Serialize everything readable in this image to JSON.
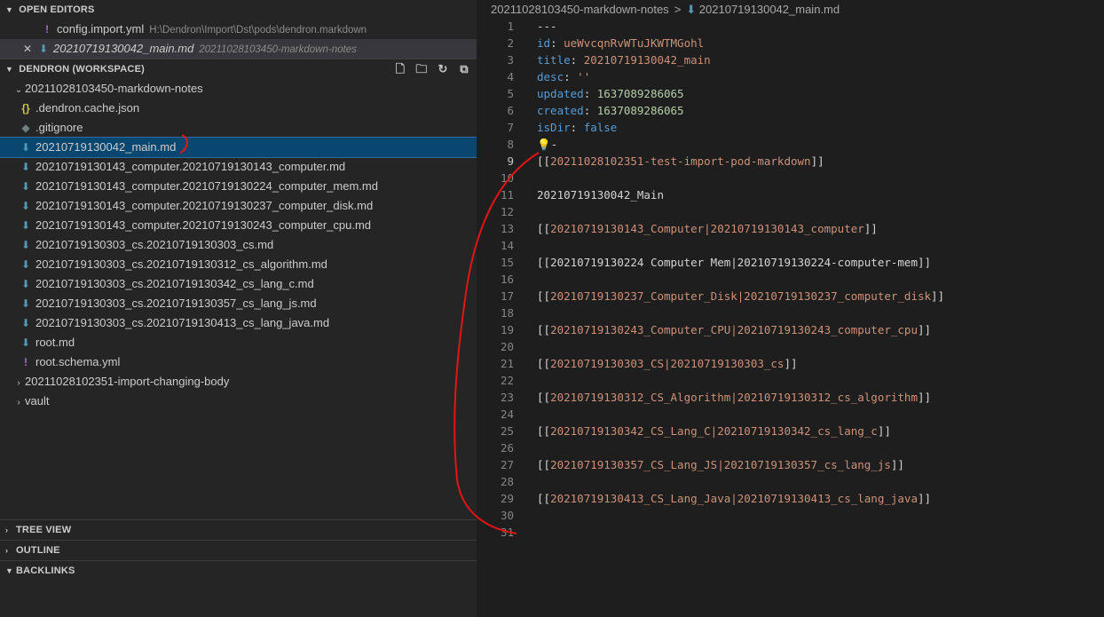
{
  "sidebar": {
    "open_editors": {
      "header": "OPEN EDITORS",
      "items": [
        {
          "name": "config.import.yml",
          "desc": "H:\\Dendron\\Import\\Dst\\pods\\dendron.markdown"
        },
        {
          "name": "20210719130042_main.md",
          "desc": "20211028103450-markdown-notes"
        }
      ]
    },
    "workspace": {
      "header": "DENDRON (WORKSPACE)",
      "folder": "20211028103450-markdown-notes",
      "files": [
        ".dendron.cache.json",
        ".gitignore",
        "20210719130042_main.md",
        "20210719130143_computer.20210719130143_computer.md",
        "20210719130143_computer.20210719130224_computer_mem.md",
        "20210719130143_computer.20210719130237_computer_disk.md",
        "20210719130143_computer.20210719130243_computer_cpu.md",
        "20210719130303_cs.20210719130303_cs.md",
        "20210719130303_cs.20210719130312_cs_algorithm.md",
        "20210719130303_cs.20210719130342_cs_lang_c.md",
        "20210719130303_cs.20210719130357_cs_lang_js.md",
        "20210719130303_cs.20210719130413_cs_lang_java.md",
        "root.md",
        "root.schema.yml"
      ],
      "collapsed_folders": [
        "20211028102351-import-changing-body",
        "vault"
      ]
    },
    "bottom_sections": [
      "TREE VIEW",
      "OUTLINE",
      "BACKLINKS"
    ]
  },
  "editor": {
    "breadcrumb": {
      "folder": "20211028103450-markdown-notes",
      "sep": ">",
      "file": "20210719130042_main.md"
    },
    "lines": {
      "l1": "---",
      "l2_key": "id",
      "l2_val": "ueWvcqnRvWTuJKWTMGohl",
      "l3_key": "title",
      "l3_val": "20210719130042_main",
      "l4_key": "desc",
      "l4_val": "''",
      "l5_key": "updated",
      "l5_val": "1637089286065",
      "l6_key": "created",
      "l6_val": "1637089286065",
      "l7_key": "isDir",
      "l7_val": "false",
      "l8": "-",
      "l9": "20211028102351-test-import-pod-markdown",
      "l11": "20210719130042_Main",
      "l13": "20210719130143_Computer|20210719130143_computer",
      "l15": "20210719130224 Computer Mem|20210719130224-computer-mem",
      "l17": "20210719130237_Computer_Disk|20210719130237_computer_disk",
      "l19": "20210719130243_Computer_CPU|20210719130243_computer_cpu",
      "l21": "20210719130303_CS|20210719130303_cs",
      "l23": "20210719130312_CS_Algorithm|20210719130312_cs_algorithm",
      "l25": "20210719130342_CS_Lang_C|20210719130342_cs_lang_c",
      "l27": "20210719130357_CS_Lang_JS|20210719130357_cs_lang_js",
      "l29": "20210719130413_CS_Lang_Java|20210719130413_cs_lang_java"
    },
    "line_numbers": [
      "1",
      "2",
      "3",
      "4",
      "5",
      "6",
      "7",
      "8",
      "9",
      "10",
      "11",
      "12",
      "13",
      "14",
      "15",
      "16",
      "17",
      "18",
      "19",
      "20",
      "21",
      "22",
      "23",
      "24",
      "25",
      "26",
      "27",
      "28",
      "29",
      "30",
      "31"
    ]
  },
  "colors": {
    "accent": "#094771",
    "link": "#ce9178",
    "key": "#569cd6",
    "number": "#b5cea8",
    "annotation": "#e51414"
  },
  "icons": {
    "md": "markdown-icon",
    "json": "json-icon",
    "yml": "yaml-icon",
    "git": "gitignore-icon"
  }
}
